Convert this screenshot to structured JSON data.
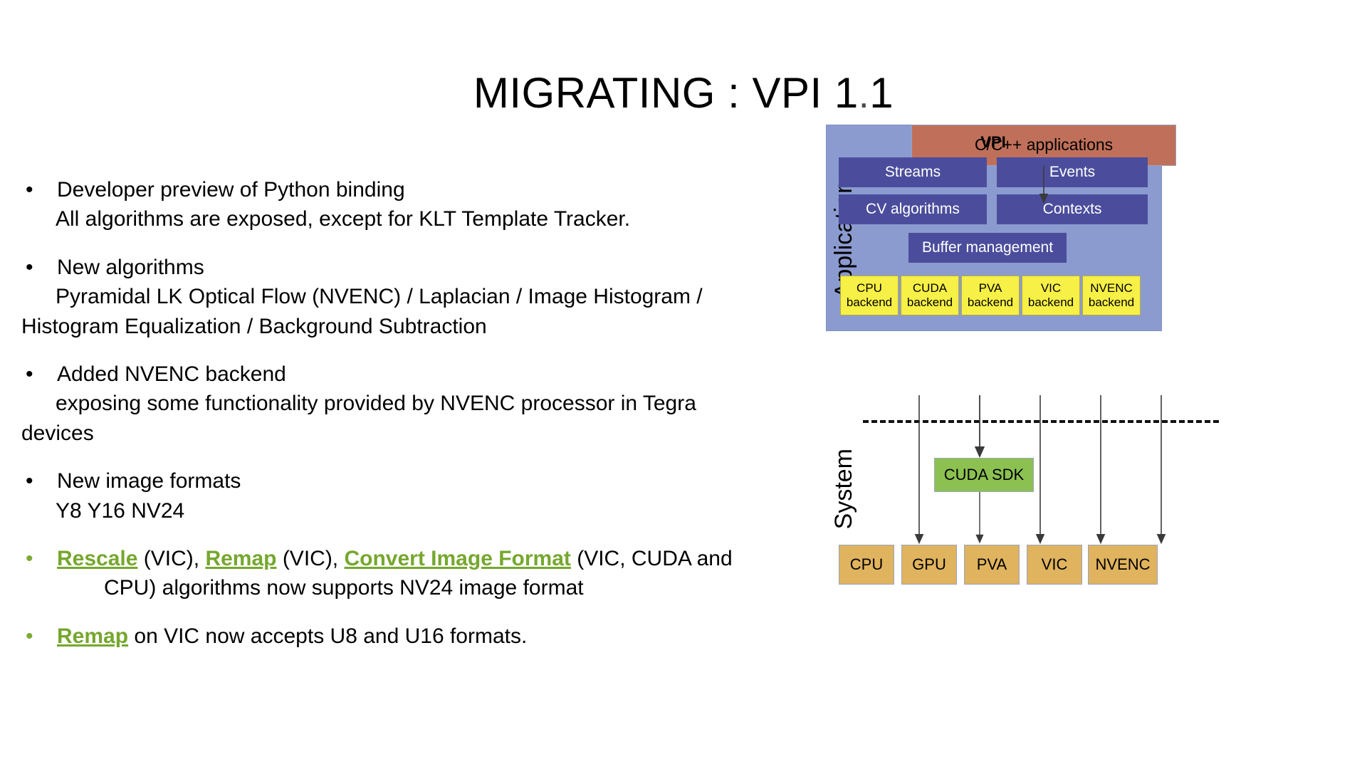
{
  "slide": {
    "title_main": "MIGRATING : VPI 1",
    "title_dot": ".",
    "title_suffix": "1"
  },
  "body": {
    "blocks": [
      {
        "bullet": "•",
        "bullet_color": "dark",
        "heading": "Developer preview of Python binding",
        "lines": [
          "All algorithms are exposed, except for KLT Template Tracker."
        ]
      },
      {
        "bullet": "•",
        "bullet_color": "dark",
        "heading": "New algorithms",
        "lines": [
          "Pyramidal LK Optical Flow (NVENC) / Laplacian / Image Histogram  /",
          "Histogram Equalization / Background Subtraction"
        ]
      },
      {
        "bullet": "•",
        "bullet_color": "dark",
        "heading": "Added NVENC backend",
        "lines": [
          "exposing some functionality provided by NVENC processor in Tegra",
          "devices"
        ]
      },
      {
        "bullet": "•",
        "bullet_color": "dark",
        "heading": "New image formats",
        "lines": [
          "Y8 Y16 NV24"
        ]
      }
    ],
    "link_bullets": [
      {
        "bullet": "•",
        "links": [
          "Rescale",
          "Remap",
          "Convert Image Format"
        ],
        "seg1": " (VIC), ",
        "seg2": " (VIC), ",
        "seg3": " (VIC, CUDA and",
        "line2": "CPU) algorithms now supports NV24 image format"
      },
      {
        "bullet": "•",
        "link": "Remap",
        "rest": " on VIC now accepts U8 and U16 formats."
      }
    ]
  },
  "diagram": {
    "labels": {
      "application": "Application",
      "system": "System"
    },
    "cpp_applications": "C/C++ applications",
    "vpi": {
      "title": "VPI",
      "streams": "Streams",
      "events": "Events",
      "cv_algorithms": "CV algorithms",
      "contexts": "Contexts",
      "buffer_management": "Buffer management"
    },
    "backends": [
      {
        "name": "CPU",
        "sub": "backend"
      },
      {
        "name": "CUDA",
        "sub": "backend"
      },
      {
        "name": "PVA",
        "sub": "backend"
      },
      {
        "name": "VIC",
        "sub": "backend"
      },
      {
        "name": "NVENC",
        "sub": "backend"
      }
    ],
    "cuda_sdk": "CUDA SDK",
    "system_hw": [
      "CPU",
      "GPU",
      "PVA",
      "VIC",
      "NVENC"
    ]
  },
  "colors": {
    "cpp_box": "#c0705a",
    "vpi_panel": "#8b9bd0",
    "vpi_sub": "#4b4d9c",
    "backend_yellow": "#f7f046",
    "cuda_sdk_green": "#8cc152",
    "system_tan": "#e0b35e",
    "link_green": "#76a72e",
    "bullet_green": "#7daa35"
  }
}
